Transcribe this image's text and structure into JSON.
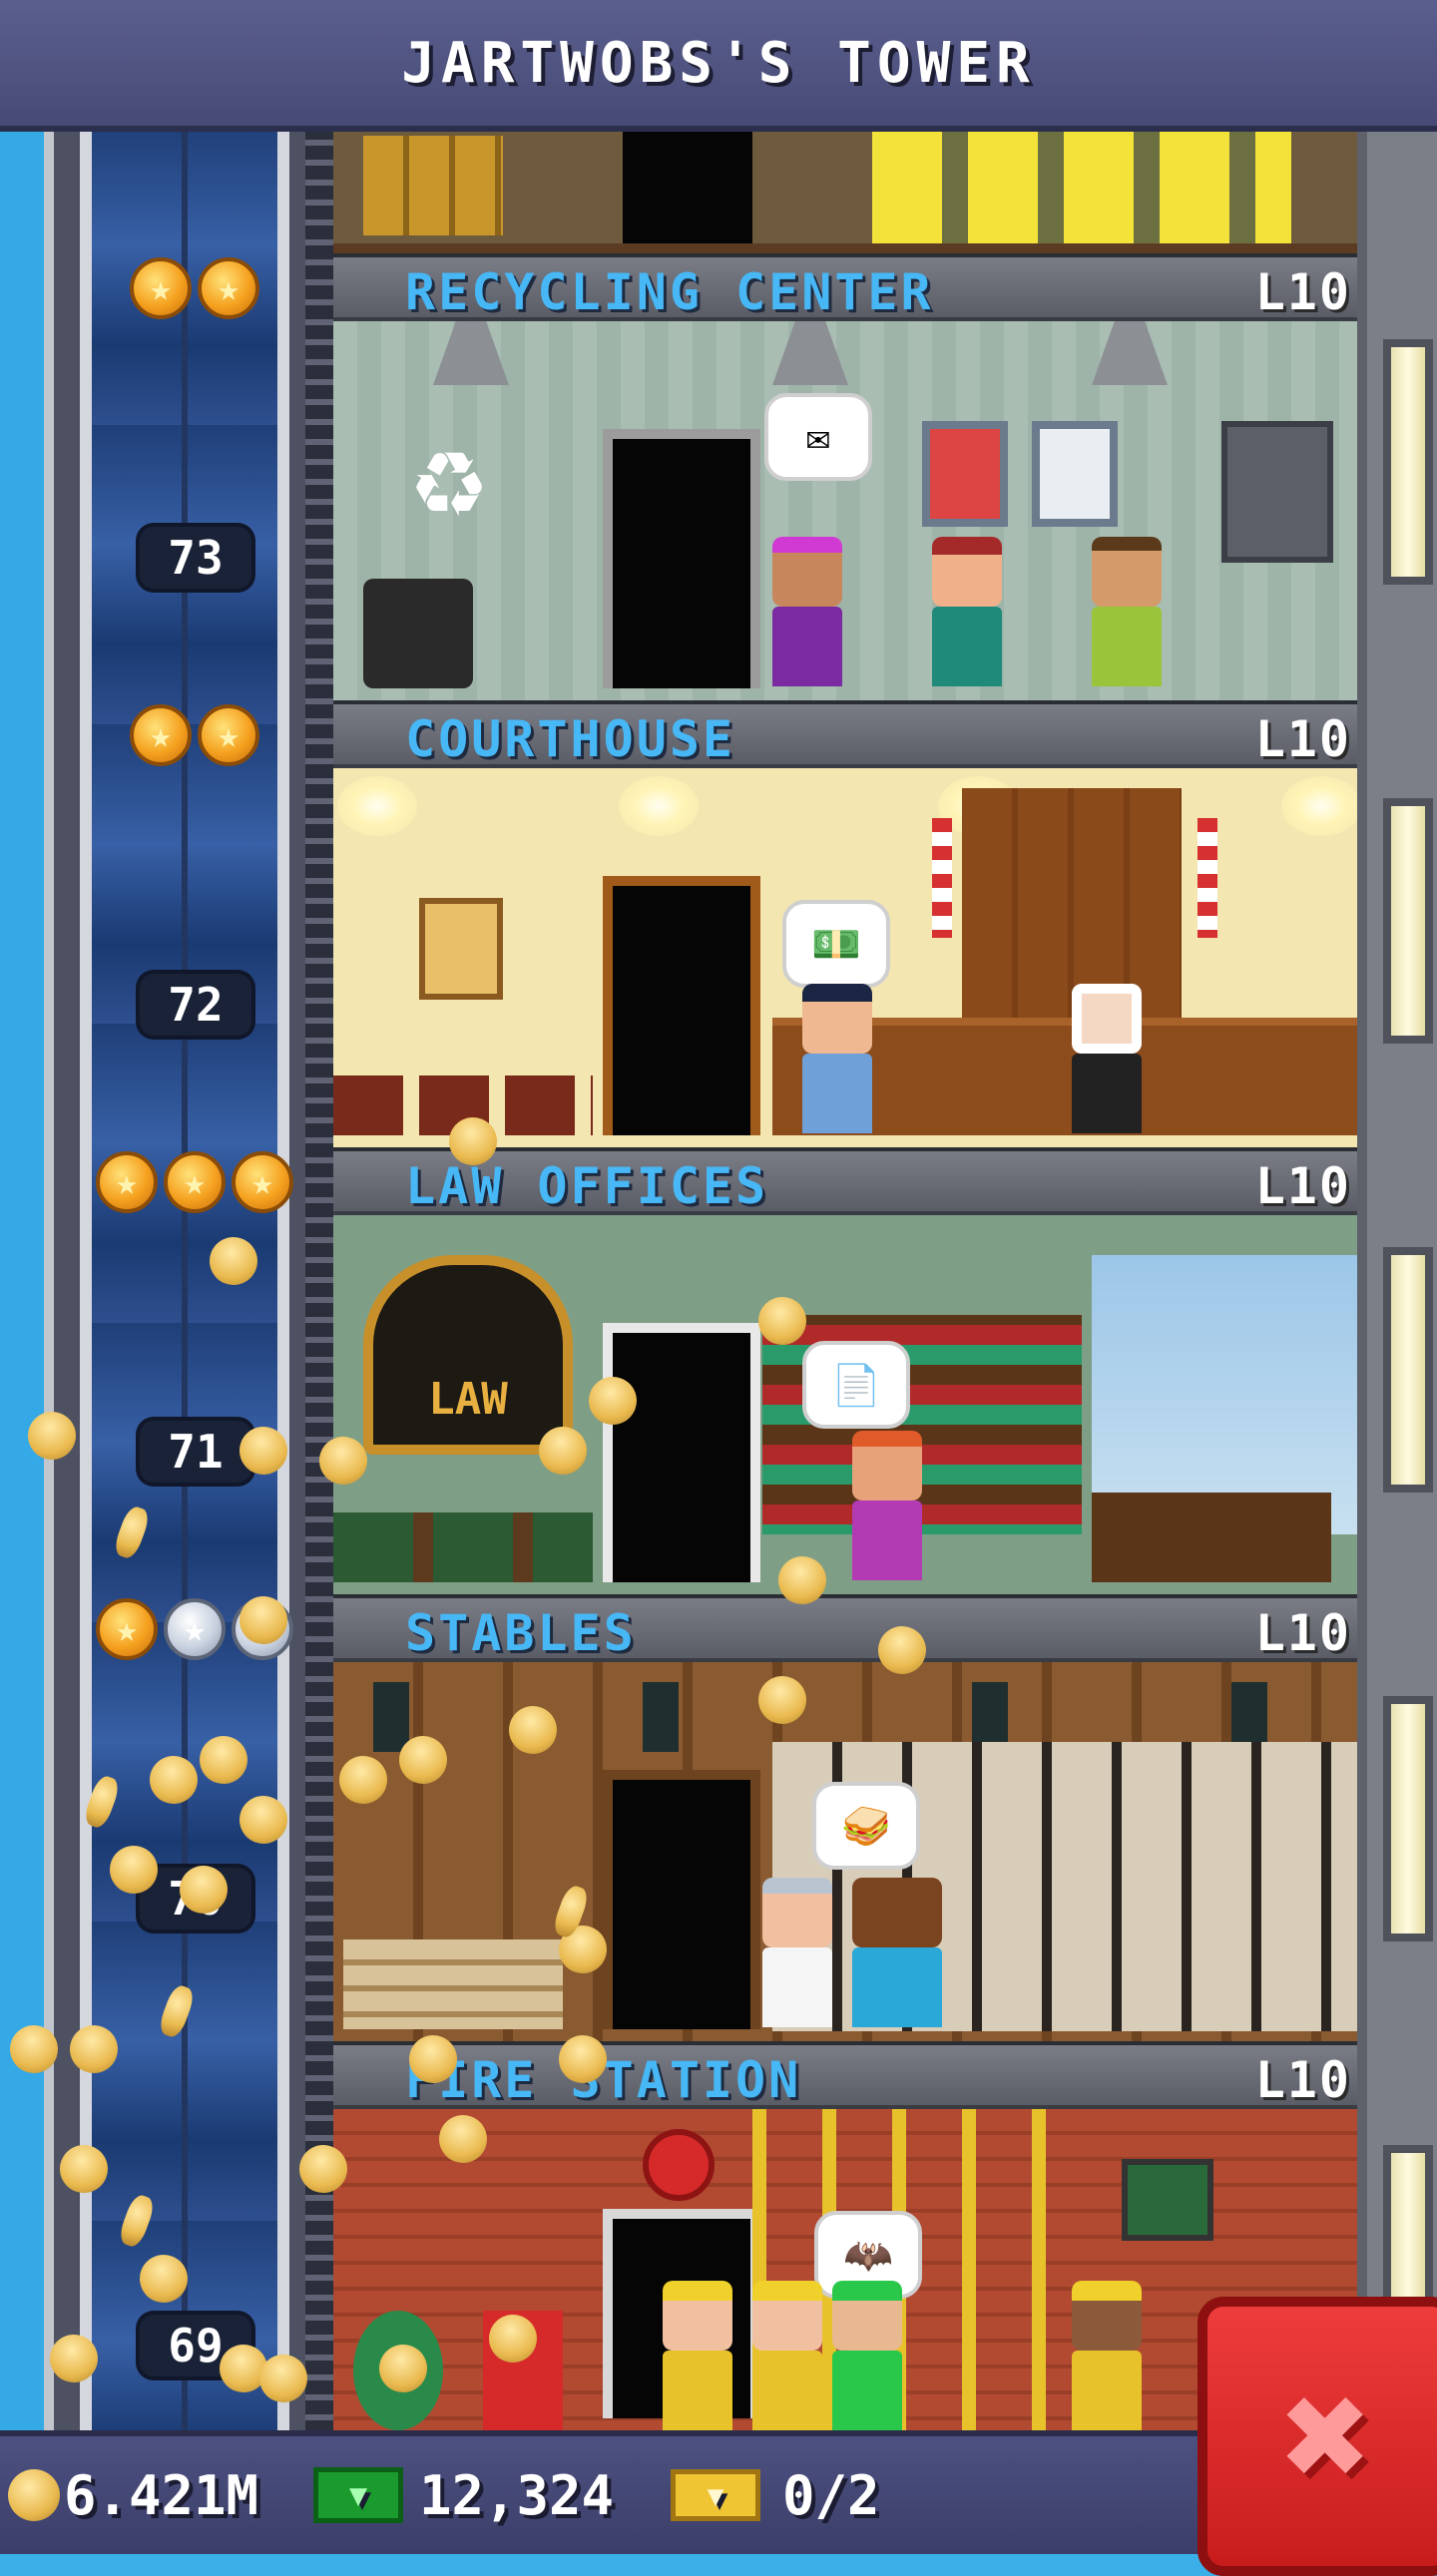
{
  "title": "JARTWOBS'S TOWER",
  "floors": [
    {
      "name": "RECYCLING CENTER",
      "level": "L10",
      "number": "73",
      "stars": [
        "gold",
        "gold"
      ],
      "bubble": "note-icon"
    },
    {
      "name": "COURTHOUSE",
      "level": "L10",
      "number": "72",
      "stars": [
        "gold",
        "gold"
      ],
      "bubble": "cash-icon"
    },
    {
      "name": "LAW OFFICES",
      "level": "L10",
      "number": "71",
      "stars": [
        "gold",
        "gold",
        "gold"
      ],
      "bubble": "document-icon",
      "sign": "LAW"
    },
    {
      "name": "STABLES",
      "level": "L10",
      "number": "70",
      "stars": [
        "gold",
        "grey",
        "grey"
      ],
      "bubble": "sandwich-icon"
    },
    {
      "name": "FIRE STATION",
      "level": "L10",
      "number": "69",
      "stars": [],
      "bubble": "bat-icon"
    }
  ],
  "status": {
    "coins": "6.421M",
    "bux": "12,324",
    "tickets": "0/2"
  },
  "colors": {
    "floor_name": "#47b7f5",
    "title_bar": "#4f5380",
    "close_button": "#d82626"
  },
  "close_label": "✖"
}
